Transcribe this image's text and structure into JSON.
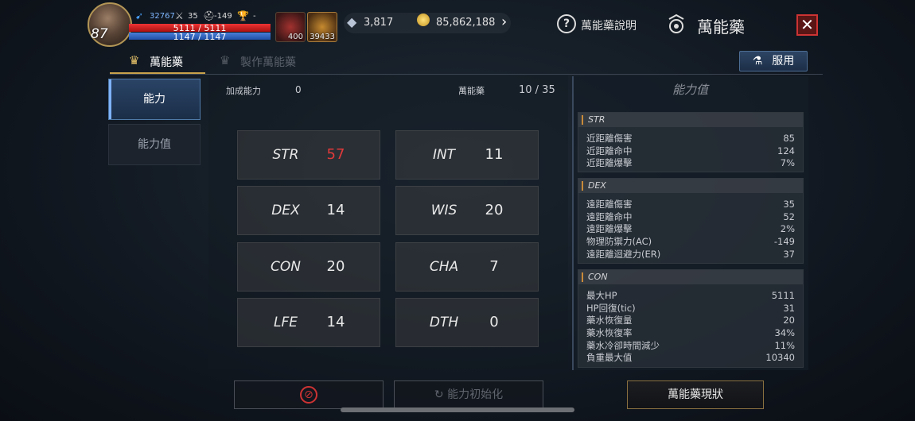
{
  "player": {
    "level": "87",
    "power": "32767",
    "stat_a": "35",
    "stat_b": "-149",
    "stat_c": "-",
    "hp": "5111 / 5111",
    "mp": "1147 / 1147"
  },
  "items": {
    "potion_count": "400",
    "elixir_count": "39433"
  },
  "currency": {
    "diamond": "3,817",
    "gold": "85,862,188"
  },
  "header": {
    "help_label": "萬能藥說明",
    "title": "萬能藥"
  },
  "tabs": [
    {
      "label": "萬能藥"
    },
    {
      "label": "製作萬能藥"
    }
  ],
  "use_button": "服用",
  "side_menu": [
    {
      "label": "能力"
    },
    {
      "label": "能力值"
    }
  ],
  "main": {
    "bonus_label": "加成能力",
    "bonus_value": "0",
    "elixir_label": "萬能藥",
    "elixir_value": "10 / 35"
  },
  "stats": [
    {
      "name": "STR",
      "value": "57"
    },
    {
      "name": "INT",
      "value": "11"
    },
    {
      "name": "DEX",
      "value": "14"
    },
    {
      "name": "WIS",
      "value": "20"
    },
    {
      "name": "CON",
      "value": "20"
    },
    {
      "name": "CHA",
      "value": "7"
    },
    {
      "name": "LFE",
      "value": "14"
    },
    {
      "name": "DTH",
      "value": "0"
    }
  ],
  "stat_panel": {
    "title": "能力值",
    "sections": [
      {
        "header": "STR",
        "rows": [
          [
            "近距離傷害",
            "85"
          ],
          [
            "近距離命中",
            "124"
          ],
          [
            "近距離爆擊",
            "7%"
          ]
        ]
      },
      {
        "header": "DEX",
        "rows": [
          [
            "遠距離傷害",
            "35"
          ],
          [
            "遠距離命中",
            "52"
          ],
          [
            "遠距離爆擊",
            "2%"
          ],
          [
            "物理防禦力(AC)",
            "-149"
          ],
          [
            "遠距離迴避力(ER)",
            "37"
          ]
        ]
      },
      {
        "header": "CON",
        "rows": [
          [
            "最大HP",
            "5111"
          ],
          [
            "HP回復(tic)",
            "31"
          ],
          [
            "藥水恢復量",
            "20"
          ],
          [
            "藥水恢復率",
            "34%"
          ],
          [
            "藥水冷卻時間減少",
            "11%"
          ],
          [
            "負重最大值",
            "10340"
          ]
        ]
      }
    ]
  },
  "bottom": {
    "reset_label": "能力初始化",
    "status_label": "萬能藥現狀"
  },
  "colors": {
    "accent": "#c9a34c",
    "danger": "#e03a3a",
    "hp": "#e33333",
    "mp": "#4a7fd8"
  }
}
